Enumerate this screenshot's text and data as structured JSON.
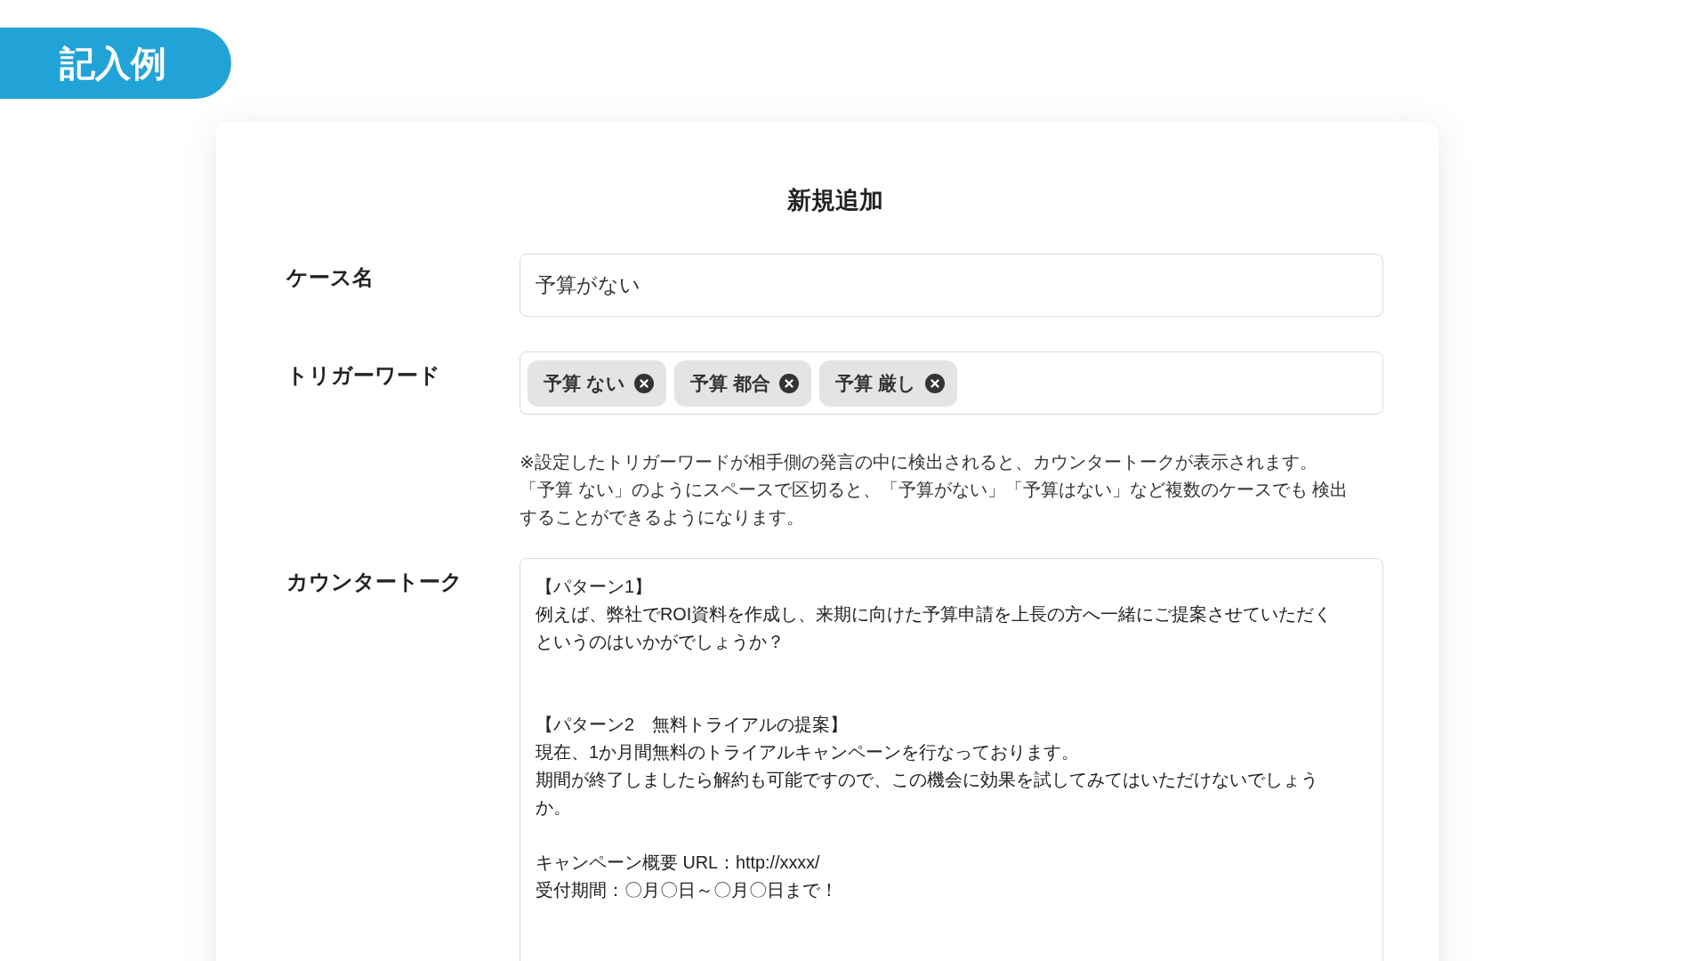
{
  "badge": "記入例",
  "form": {
    "title": "新規追加",
    "case_name": {
      "label": "ケース名",
      "value": "予算がない"
    },
    "trigger_words": {
      "label": "トリガーワード",
      "tags": [
        {
          "label": "予算 ない"
        },
        {
          "label": "予算 都合"
        },
        {
          "label": "予算 厳し"
        }
      ]
    },
    "note": [
      "※設定したトリガーワードが相手側の発言の中に検出されると、カウンタートークが表示されます。",
      "「予算 ない」のようにスペースで区切ると、「予算がない」「予算はない」など複数のケースでも 検出",
      "することができるようになります。"
    ],
    "counter_talk": {
      "label": "カウンタートーク",
      "lines": [
        {
          "kind": "text",
          "text": "【パターン1】"
        },
        {
          "kind": "text",
          "text": "例えば、弊社でROI資料を作成し、来期に向けた予算申請を上長の方へ一緒にご提案させていただく"
        },
        {
          "kind": "text",
          "text": "というのはいかがでしょうか？"
        },
        {
          "kind": "blank"
        },
        {
          "kind": "blank"
        },
        {
          "kind": "text",
          "text": "【パターン2　無料トライアルの提案】"
        },
        {
          "kind": "text",
          "text": "現在、1か月間無料のトライアルキャンペーンを行なっております。"
        },
        {
          "kind": "text",
          "text": "期間が終了しましたら解約も可能ですので、この機会に効果を試してみてはいただけないでしょう"
        },
        {
          "kind": "text",
          "text": "か。"
        },
        {
          "kind": "blank"
        },
        {
          "kind": "text",
          "text": "キャンペーン概要 URL：http://xxxx/"
        },
        {
          "kind": "text",
          "text": "受付期間：〇月〇日～〇月〇日まで！"
        }
      ]
    }
  }
}
